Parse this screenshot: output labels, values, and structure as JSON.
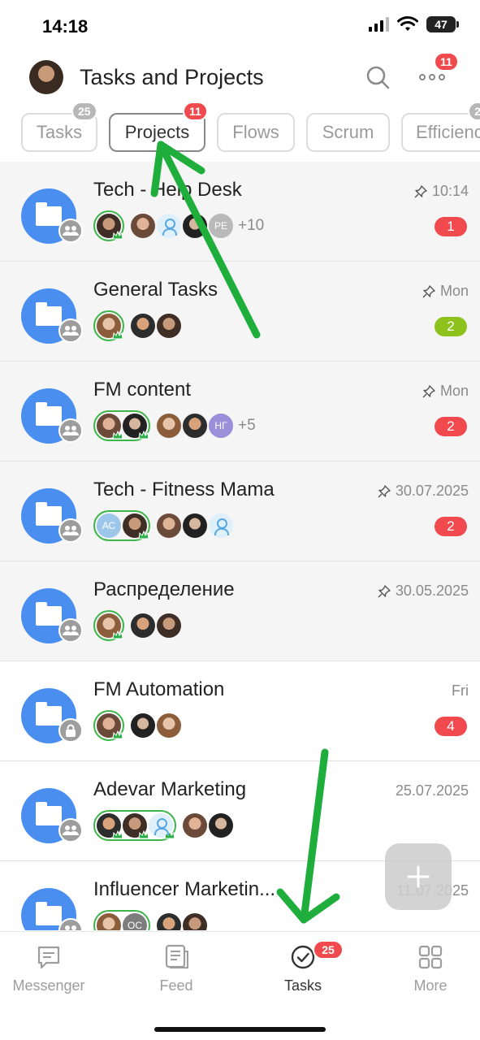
{
  "status_bar": {
    "time": "14:18",
    "battery": "47"
  },
  "header": {
    "title": "Tasks and Projects",
    "more_badge": "11"
  },
  "tabs": [
    {
      "label": "Tasks",
      "badge": "25",
      "badge_color": "grey"
    },
    {
      "label": "Projects",
      "badge": "11",
      "badge_color": "red",
      "active": true
    },
    {
      "label": "Flows"
    },
    {
      "label": "Scrum"
    },
    {
      "label": "Efficienc",
      "badge": "2",
      "badge_color": "grey"
    }
  ],
  "projects": [
    {
      "title": "Tech - Help Desk",
      "time": "10:14",
      "pinned": true,
      "counter": "1",
      "counter_color": "#f04a4f",
      "type_icon": "group-icon",
      "owners": [
        "photo"
      ],
      "members": [
        "photo",
        "user-placeholder",
        "photo",
        "PE"
      ],
      "more": "+10"
    },
    {
      "title": "General Tasks",
      "time": "Mon",
      "pinned": true,
      "counter": "2",
      "counter_color": "#8cc21b",
      "type_icon": "group-icon",
      "owners": [
        "photo"
      ],
      "members": [
        "photo",
        "photo"
      ],
      "more": ""
    },
    {
      "title": " FM content",
      "time": "Mon",
      "pinned": true,
      "counter": "2",
      "counter_color": "#f04a4f",
      "type_icon": "group-icon",
      "owners": [
        "photo",
        "photo"
      ],
      "members": [
        "photo",
        "photo",
        "НГ"
      ],
      "more": "+5"
    },
    {
      "title": "Tech - Fitness Mama",
      "time": "30.07.2025",
      "pinned": true,
      "counter": "2",
      "counter_color": "#f04a4f",
      "type_icon": "group-icon",
      "owners": [
        "АС",
        "photo"
      ],
      "members": [
        "photo",
        "photo",
        "user-placeholder"
      ],
      "more": ""
    },
    {
      "title": "Распределение",
      "time": "30.05.2025",
      "pinned": true,
      "counter": "",
      "type_icon": "group-icon",
      "owners": [
        "photo"
      ],
      "members": [
        "photo",
        "photo"
      ],
      "more": ""
    },
    {
      "title": "FM Automation",
      "time": "Fri",
      "pinned": false,
      "counter": "4",
      "counter_color": "#f04a4f",
      "type_icon": "lock-icon",
      "owners": [
        "photo"
      ],
      "members": [
        "photo",
        "photo"
      ],
      "more": ""
    },
    {
      "title": " Adevar Marketing",
      "time": "25.07.2025",
      "pinned": false,
      "counter": "",
      "type_icon": "group-icon",
      "owners": [
        "photo",
        "photo",
        "user-placeholder"
      ],
      "members": [
        "photo",
        "photo"
      ],
      "more": ""
    },
    {
      "title": "Influencer Marketin...",
      "time": "11.07.2025",
      "pinned": false,
      "counter": "",
      "type_icon": "group-icon",
      "owners": [
        "photo",
        "ОС"
      ],
      "members": [
        "photo",
        "photo"
      ],
      "more": ""
    }
  ],
  "bottom_nav": [
    {
      "label": "Messenger",
      "icon": "chat-icon"
    },
    {
      "label": "Feed",
      "icon": "feed-icon"
    },
    {
      "label": "Tasks",
      "icon": "tasks-check-icon",
      "badge": "25",
      "active": true
    },
    {
      "label": "More",
      "icon": "grid-icon"
    }
  ],
  "colors": {
    "accent": "#4a8ff0",
    "badge_red": "#f04a4f",
    "badge_green": "#8cc21b",
    "owner_ring": "#3cb64a",
    "annotation_arrow": "#1fae3c"
  }
}
